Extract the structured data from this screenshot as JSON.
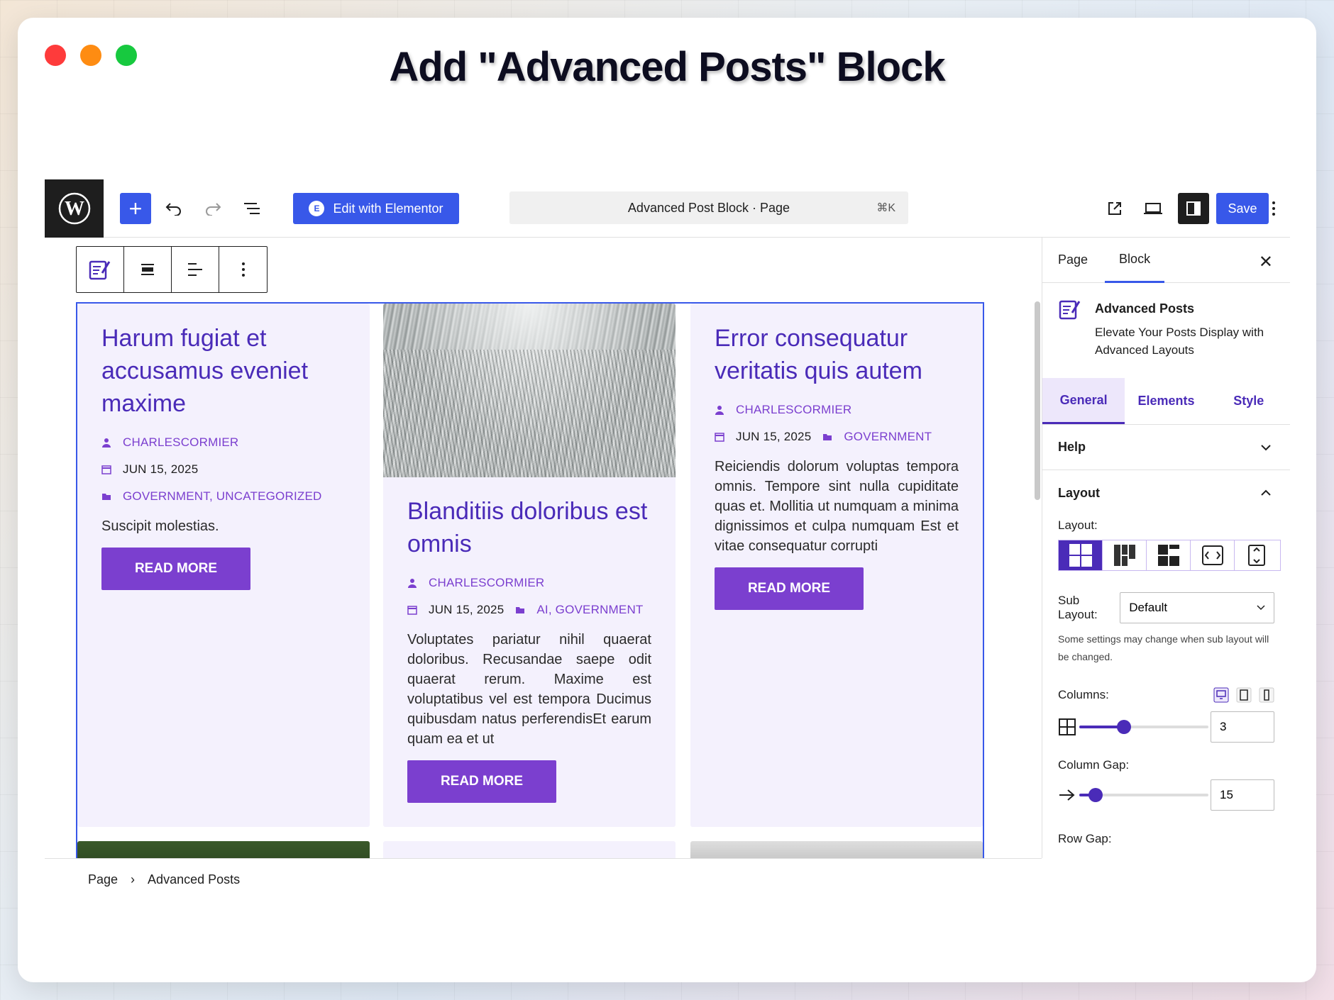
{
  "headline": "Add \"Advanced Posts\" Block",
  "toolbar": {
    "edit_elementor": "Edit with Elementor",
    "command_title": "Advanced Post Block · Page",
    "command_shortcut": "⌘K",
    "save": "Save"
  },
  "posts": [
    {
      "title": "Harum fugiat et accusamus eveniet maxime",
      "author": "CHARLESCORMIER",
      "date": "JUN 15, 2025",
      "categories": "GOVERNMENT, UNCATEGORIZED",
      "excerpt": "Suscipit molestias.",
      "button": "READ MORE"
    },
    {
      "title": "Blanditiis doloribus est omnis",
      "author": "CHARLESCORMIER",
      "date": "JUN 15, 2025",
      "categories": "AI, GOVERNMENT",
      "excerpt": "Voluptates pariatur nihil quaerat doloribus. Recusandae saepe odit quaerat rerum. Maxime est voluptatibus vel est tempora Ducimus quibusdam natus perferendisEt earum quam ea et ut",
      "button": "READ MORE"
    },
    {
      "title": "Error consequatur veritatis quis autem",
      "author": "CHARLESCORMIER",
      "date": "JUN 15, 2025",
      "categories": "GOVERNMENT",
      "excerpt": "Reiciendis dolorum voluptas tempora omnis. Tempore sint nulla cupiditate quas et. Mollitia ut numquam a minima dignissimos et culpa numquam Est et vitae consequatur corrupti",
      "button": "READ MORE"
    }
  ],
  "breadcrumb": {
    "root": "Page",
    "current": "Advanced Posts"
  },
  "sidebar": {
    "tabs": [
      "Page",
      "Block"
    ],
    "block_title": "Advanced Posts",
    "block_desc": "Elevate Your Posts Display with Advanced Layouts",
    "subtabs": [
      "General",
      "Elements",
      "Style"
    ],
    "help": "Help",
    "layout_section": "Layout",
    "layout_label": "Layout:",
    "sub_layout_label": "Sub Layout:",
    "sub_layout_value": "Default",
    "note": "Some settings may change when sub layout will be changed.",
    "columns_label": "Columns:",
    "columns_value": "3",
    "columns_fraction": 0.35,
    "gap_label": "Column Gap:",
    "gap_value": "15",
    "gap_fraction": 0.13,
    "row_gap_label": "Row Gap:"
  },
  "colors": {
    "accent": "#3858e9",
    "purple": "#7b3fcf",
    "title_purple": "#4a2bb8",
    "card_bg": "#f4f1fd"
  }
}
